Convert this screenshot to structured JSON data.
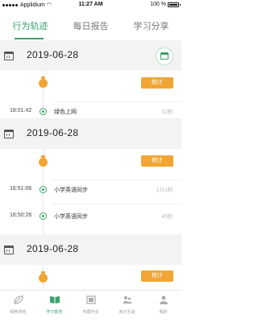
{
  "status_bar": {
    "carrier": "Applidium",
    "time": "11:27 AM",
    "battery": "100 %"
  },
  "tabs": [
    {
      "label": "行为轨迹",
      "active": true
    },
    {
      "label": "每日报告",
      "active": false
    },
    {
      "label": "学习分享",
      "active": false
    }
  ],
  "sections": [
    {
      "date": "2019-06-28",
      "stat_label": "统计",
      "entries": [
        {
          "time": "18:01:42",
          "name": "绿色上网",
          "duration": "32秒"
        }
      ]
    },
    {
      "date": "2019-06-28",
      "stat_label": "统计",
      "entries": [
        {
          "time": "16:51:06",
          "name": "小学英语同步",
          "duration": "1分1秒"
        },
        {
          "time": "16:50:26",
          "name": "小学英语同步",
          "duration": "40秒"
        }
      ]
    },
    {
      "date": "2019-06-28",
      "stat_label": "统计",
      "entries": []
    }
  ],
  "bottom_nav": [
    {
      "label": "绿色背包",
      "icon": "leaf-icon",
      "active": false
    },
    {
      "label": "学习报告",
      "icon": "book-icon",
      "active": true
    },
    {
      "label": "布置作业",
      "icon": "film-icon",
      "active": false
    },
    {
      "label": "亲子互动",
      "icon": "people-icon",
      "active": false
    },
    {
      "label": "我的",
      "icon": "person-icon",
      "active": false
    }
  ],
  "colors": {
    "accent": "#3aa26b",
    "stat": "#f0a534",
    "section_bg": "#f3f3f3"
  }
}
